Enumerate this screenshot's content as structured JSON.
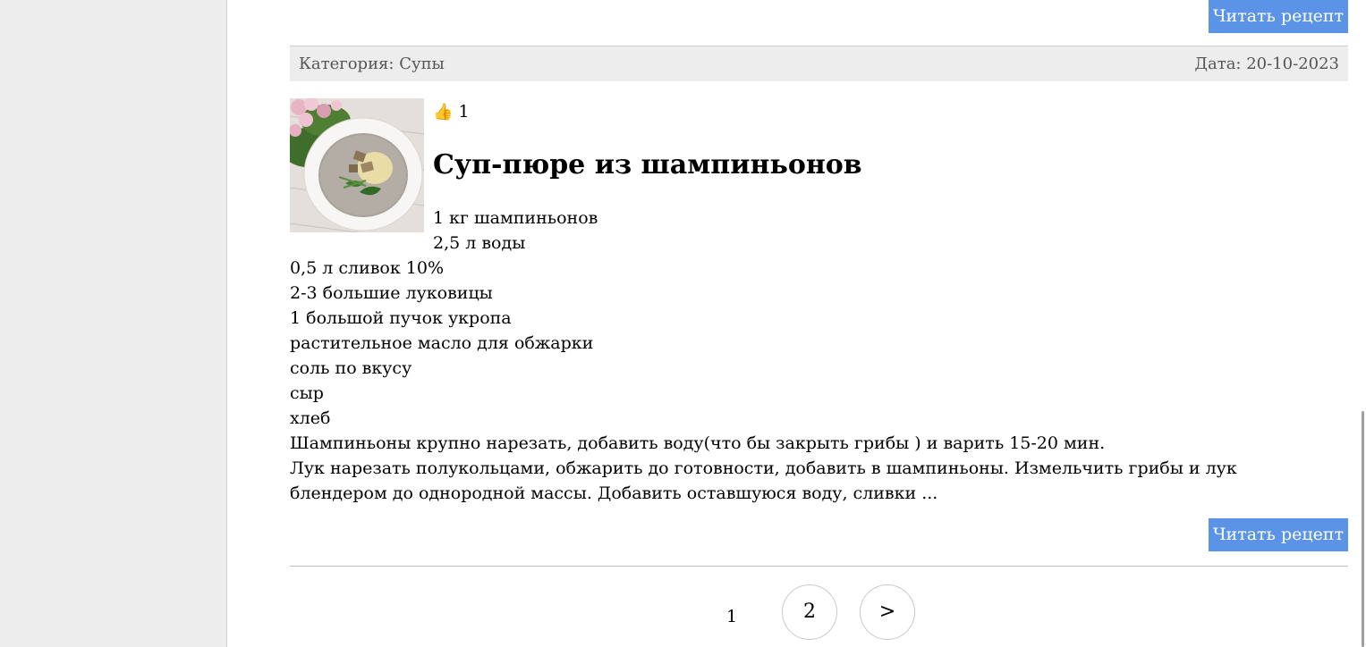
{
  "prev_recipe": {
    "read_button": "Читать рецепт"
  },
  "recipe": {
    "category": "Категория: Супы",
    "date": "Дата: 20-10-2023",
    "likes": "1",
    "like_icon": "👍",
    "title": "Суп-пюре из шампиньонов",
    "ingredients": [
      "1 кг шампиньонов",
      "2,5 л воды",
      "0,5 л сливок 10%",
      "2-3 большие луковицы",
      "1 большой пучок укропа",
      "растительное масло для обжарки",
      "соль по вкусу",
      "сыр",
      "хлеб"
    ],
    "description": [
      "Шампиньоны крупно нарезать, добавить воду(что бы закрыть грибы ) и варить 15-20 мин.",
      "Лук нарезать полукольцами, обжарить до готовности, добавить в шампиньоны. Измельчить грибы и лук",
      "блендером до однородной массы. Добавить оставшуюся воду, сливки ..."
    ],
    "read_button": "Читать рецепт"
  },
  "pagination": {
    "pages": [
      "1",
      "2"
    ],
    "next": ">"
  }
}
